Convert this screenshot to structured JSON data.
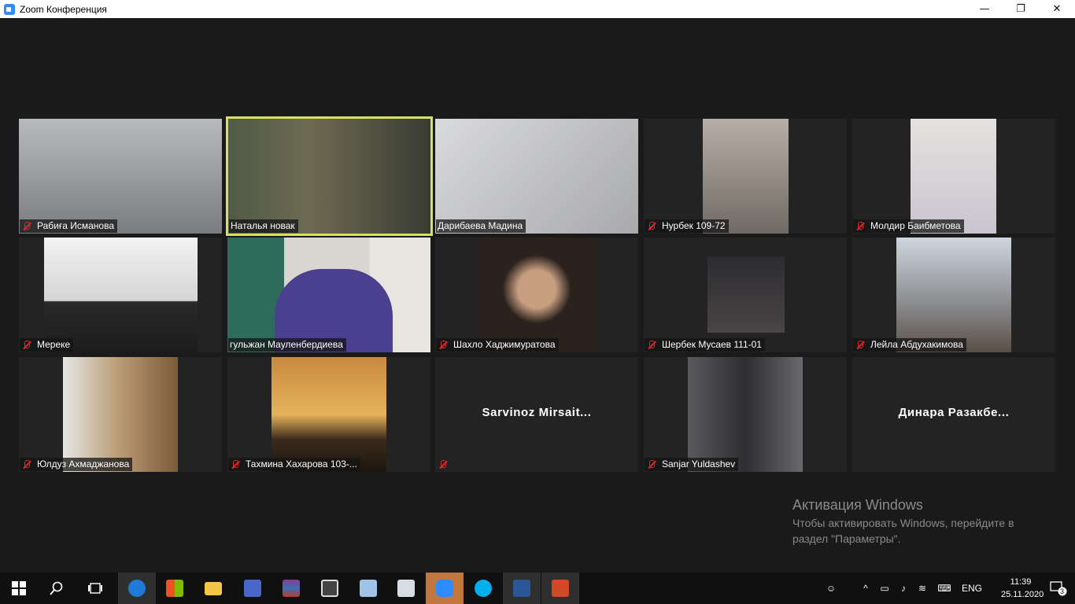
{
  "window": {
    "title": "Zoom Конференция",
    "buttons": [
      "—",
      "❐",
      "✕"
    ]
  },
  "participants": [
    {
      "name": "Рабиға Исманова",
      "muted": true,
      "video": true,
      "active": false,
      "bg": "#9fa3a6"
    },
    {
      "name": "Наталья новак",
      "muted": false,
      "video": true,
      "active": true,
      "bg": "#5a5746"
    },
    {
      "name": "Дарибаева Мадина",
      "muted": false,
      "video": true,
      "active": false,
      "bg": "#c7c9cc"
    },
    {
      "name": "Нурбек 109-72",
      "muted": true,
      "video": true,
      "active": false,
      "bg": "#8d8a85"
    },
    {
      "name": "Молдир Баибметова",
      "muted": true,
      "video": true,
      "active": false,
      "bg": "#d8d3d2"
    },
    {
      "name": "Мереке",
      "muted": true,
      "video": true,
      "active": false,
      "bg": "#e9eae9"
    },
    {
      "name": "гульжан Мауленбердиева",
      "muted": false,
      "video": true,
      "active": false,
      "bg": "#5c5276"
    },
    {
      "name": "Шахло Хаджимуратова",
      "muted": true,
      "video": true,
      "active": false,
      "bg": "#2b221d"
    },
    {
      "name": "Шербек Мусаев 111-01",
      "muted": true,
      "video": true,
      "active": false,
      "bg": "#2a2a2e"
    },
    {
      "name": "Лейла Абдухакимова",
      "muted": true,
      "video": true,
      "active": false,
      "bg": "#9d9fa5"
    },
    {
      "name": "Юлдуз Ахмаджанова",
      "muted": true,
      "video": true,
      "active": false,
      "bg": "#8e7b62"
    },
    {
      "name": "Тахмина Хахарова 103-...",
      "muted": true,
      "video": true,
      "active": false,
      "bg": "#8b6b3e"
    },
    {
      "name": "",
      "display_name": "Sarvinoz  Mirsait...",
      "muted": true,
      "video": false,
      "active": false,
      "bg": "#232323"
    },
    {
      "name": "Sanjar Yuldashev",
      "muted": true,
      "video": true,
      "active": false,
      "bg": "#3a3a3c"
    },
    {
      "name": "",
      "display_name": "Динара  Разакбе...",
      "muted": false,
      "video": false,
      "active": false,
      "bg": "#232323"
    }
  ],
  "activation": {
    "title": "Активация Windows",
    "line1": "Чтобы активировать Windows, перейдите в",
    "line2": "раздел \"Параметры\"."
  },
  "taskbar": {
    "apps": [
      "windows-start-icon",
      "search-icon",
      "task-view-icon",
      "edge-icon",
      "store-icon",
      "file-explorer-icon",
      "disk-icon",
      "winrar-icon",
      "calculator-icon",
      "notepad-icon",
      "documents-icon",
      "zoom-icon",
      "skype-icon",
      "word-icon",
      "powerpoint-icon"
    ],
    "lang": "ENG",
    "time": "11:39",
    "date": "25.11.2020",
    "notifications": "3"
  }
}
